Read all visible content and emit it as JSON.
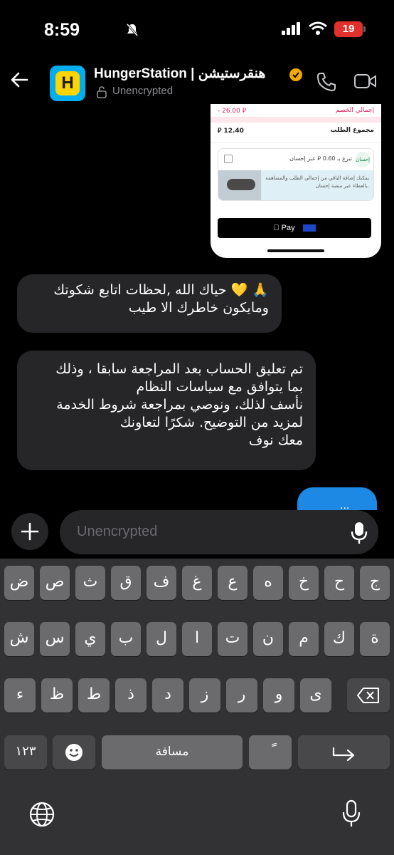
{
  "status_bar": {
    "time": "8:59",
    "battery": "19"
  },
  "header": {
    "title": "HungerStation | هنقرستيشن",
    "subtitle": "Unencrypted",
    "avatar_letter": "H"
  },
  "receipt": {
    "discount_label": "إجمالي الخصم",
    "discount_value": "- 26.00 ⃁",
    "total_label": "مجموع الطلب",
    "total_value": "⃁ 12.40",
    "ehsan_text": "تبرع بـ 0.60 ⃁ عبر إحسان",
    "ehsan_logo": "إحسان",
    "ehsan_desc": "يمكنك إضافة الباقي من إجمالي الطلب والمساهمة بالعطاء عبر منصة إحسان.",
    "apple_pay": "Pay"
  },
  "messages": {
    "m1": [
      "🙏 💛 حياك الله ,لحظات اتابع شكوتك",
      "ومايكون خاطرك الا طيب"
    ],
    "m2": [
      "تم تعليق الحساب بعد المراجعة سابقا ، وذلك",
      "بما يتوافق مع سياسات النظام",
      "نأسف لذلك، ونوصي بمراجعة شروط الخدمة",
      "لمزيد من التوضيح. شكرًا لتعاونك",
      "معك نوف"
    ],
    "outgoing_partial": "..."
  },
  "composer": {
    "placeholder": "Unencrypted"
  },
  "keyboard": {
    "row1": [
      "ض",
      "ص",
      "ث",
      "ق",
      "ف",
      "غ",
      "ع",
      "ه",
      "خ",
      "ح",
      "ج"
    ],
    "row2": [
      "ش",
      "س",
      "ي",
      "ب",
      "ل",
      "ا",
      "ت",
      "ن",
      "م",
      "ك",
      "ة"
    ],
    "row3": [
      "ء",
      "ظ",
      "ط",
      "ذ",
      "د",
      "ز",
      "ر",
      "و",
      "ى"
    ],
    "numbers_key": "١٢٣",
    "space_key": "مسافة",
    "tashkeel_key": "ً"
  },
  "colors": {
    "accent": "#1e88e5",
    "bubble": "#262629",
    "keyboard_bg": "#323235",
    "key": "#6b6b6e"
  }
}
